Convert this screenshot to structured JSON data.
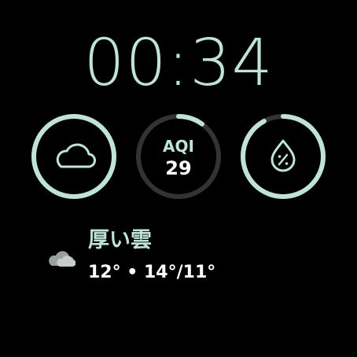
{
  "time": "00:34",
  "complications": {
    "weather": {
      "icon": "cloud-icon",
      "progress": 1.0
    },
    "aqi": {
      "label": "AQI",
      "value": "29",
      "progress": 0.1
    },
    "humidity": {
      "icon": "humidity-percent-icon",
      "progress": 0.92
    }
  },
  "forecast": {
    "icon": "cloudy-icon",
    "condition": "厚い雲",
    "temperatures": "12° • 14°/11°"
  },
  "colors": {
    "accent": "#bfe3d8",
    "track": "#333333",
    "value_text": "#ffffff",
    "background": "#000000",
    "forecast_icon": "#c8cccc"
  }
}
